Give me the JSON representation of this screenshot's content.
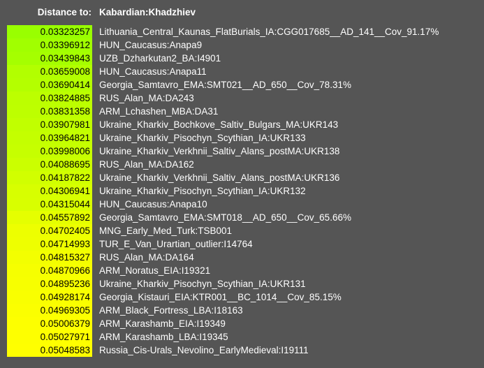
{
  "header": {
    "distance_label": "Distance to:",
    "target": "Kabardian:Khadzhiev"
  },
  "colors": {
    "background": "#555555",
    "gradient_start": "#99ff00",
    "gradient_end": "#ffff00"
  },
  "rows": [
    {
      "distance": "0.03323257",
      "name": "Lithuania_Central_Kaunas_FlatBurials_IA:CGG017685__AD_141__Cov_91.17%",
      "color": "#99ff00"
    },
    {
      "distance": "0.03396912",
      "name": "HUN_Caucasus:Anapa9",
      "color": "#a1ff00"
    },
    {
      "distance": "0.03439843",
      "name": "UZB_Dzharkutan2_BA:I4901",
      "color": "#a5ff00"
    },
    {
      "distance": "0.03659008",
      "name": "HUN_Caucasus:Anapa11",
      "color": "#b2ff00"
    },
    {
      "distance": "0.03690414",
      "name": "Georgia_Samtavro_EMA:SMT021__AD_650__Cov_78.31%",
      "color": "#b4ff00"
    },
    {
      "distance": "0.03824885",
      "name": "RUS_Alan_MA:DA243",
      "color": "#bcff00"
    },
    {
      "distance": "0.03831358",
      "name": "ARM_Lchashen_MBA:DA31",
      "color": "#bdff00"
    },
    {
      "distance": "0.03907981",
      "name": "Ukraine_Kharkiv_Bochkove_Saltiv_Bulgars_MA:UKR143",
      "color": "#c1ff00"
    },
    {
      "distance": "0.03964821",
      "name": "Ukraine_Kharkiv_Pisochyn_Scythian_IA:UKR133",
      "color": "#c4ff00"
    },
    {
      "distance": "0.03998006",
      "name": "Ukraine_Kharkiv_Verkhnii_Saltiv_Alans_postMA:UKR138",
      "color": "#c6ff00"
    },
    {
      "distance": "0.04088695",
      "name": "RUS_Alan_MA:DA162",
      "color": "#cbff00"
    },
    {
      "distance": "0.04187822",
      "name": "Ukraine_Kharkiv_Verkhnii_Saltiv_Alans_postMA:UKR136",
      "color": "#d1ff00"
    },
    {
      "distance": "0.04306941",
      "name": "Ukraine_Kharkiv_Pisochyn_Scythian_IA:UKR132",
      "color": "#d7ff00"
    },
    {
      "distance": "0.04315044",
      "name": "HUN_Caucasus:Anapa10",
      "color": "#d8ff00"
    },
    {
      "distance": "0.04557892",
      "name": "Georgia_Samtavro_EMA:SMT018__AD_650__Cov_65.66%",
      "color": "#e5ff00"
    },
    {
      "distance": "0.04702405",
      "name": "MNG_Early_Med_Turk:TSB001",
      "color": "#edff00"
    },
    {
      "distance": "0.04714993",
      "name": "TUR_E_Van_Urartian_outlier:I14764",
      "color": "#eeff00"
    },
    {
      "distance": "0.04815327",
      "name": "RUS_Alan_MA:DA164",
      "color": "#f3ff00"
    },
    {
      "distance": "0.04870966",
      "name": "ARM_Noratus_EIA:I19321",
      "color": "#f6ff00"
    },
    {
      "distance": "0.04895236",
      "name": "Ukraine_Kharkiv_Pisochyn_Scythian_IA:UKR131",
      "color": "#f7ff00"
    },
    {
      "distance": "0.04928174",
      "name": "Georgia_Kistauri_EIA:KTR001__BC_1014__Cov_85.15%",
      "color": "#f9ff00"
    },
    {
      "distance": "0.04969305",
      "name": "ARM_Black_Fortress_LBA:I18163",
      "color": "#fbff00"
    },
    {
      "distance": "0.05006379",
      "name": "ARM_Karashamb_EIA:I19349",
      "color": "#fdff00"
    },
    {
      "distance": "0.05027971",
      "name": "ARM_Karashamb_LBA:I19345",
      "color": "#feff00"
    },
    {
      "distance": "0.05048583",
      "name": "Russia_Cis-Urals_Nevolino_EarlyMedieval:I19111",
      "color": "#ffff00"
    }
  ]
}
